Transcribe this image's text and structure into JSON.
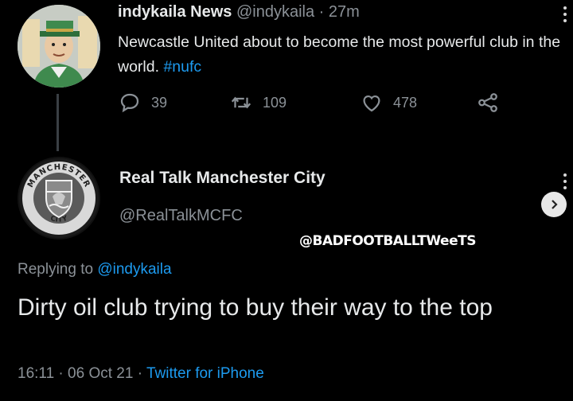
{
  "tweet1": {
    "display_name": "indykaila",
    "name_suffix": "News",
    "handle": "@indykaila",
    "separator": "·",
    "time": "27m",
    "text_main": "Newcastle United about to become the most powerful club in the world.",
    "hashtag": "#nufc",
    "reply_count": "39",
    "retweet_count": "109",
    "like_count": "478"
  },
  "tweet2": {
    "display_name": "Real Talk Manchester City",
    "handle": "@RealTalkMCFC",
    "avatar_ring_top": "MANCHESTER",
    "avatar_ring_bottom": "CITY",
    "replying_prefix": "Replying to",
    "replying_mention": "@indykaila",
    "text": "Dirty oil club trying to buy their way to the top",
    "time": "16:11",
    "date": "06 Oct 21",
    "client": "Twitter for iPhone",
    "separator": "·"
  },
  "watermark": "@BADFOOTBALLTWeeTS",
  "icons": {
    "reply": "speech-bubble-icon",
    "retweet": "retweet-arrows-icon",
    "like": "heart-icon",
    "share": "share-nodes-icon",
    "more": "vertical-dots-icon",
    "next": "chevron-right-icon"
  },
  "colors": {
    "background": "#000000",
    "text": "#e7e9ea",
    "muted": "#8b9197",
    "link": "#1d9bf0"
  }
}
